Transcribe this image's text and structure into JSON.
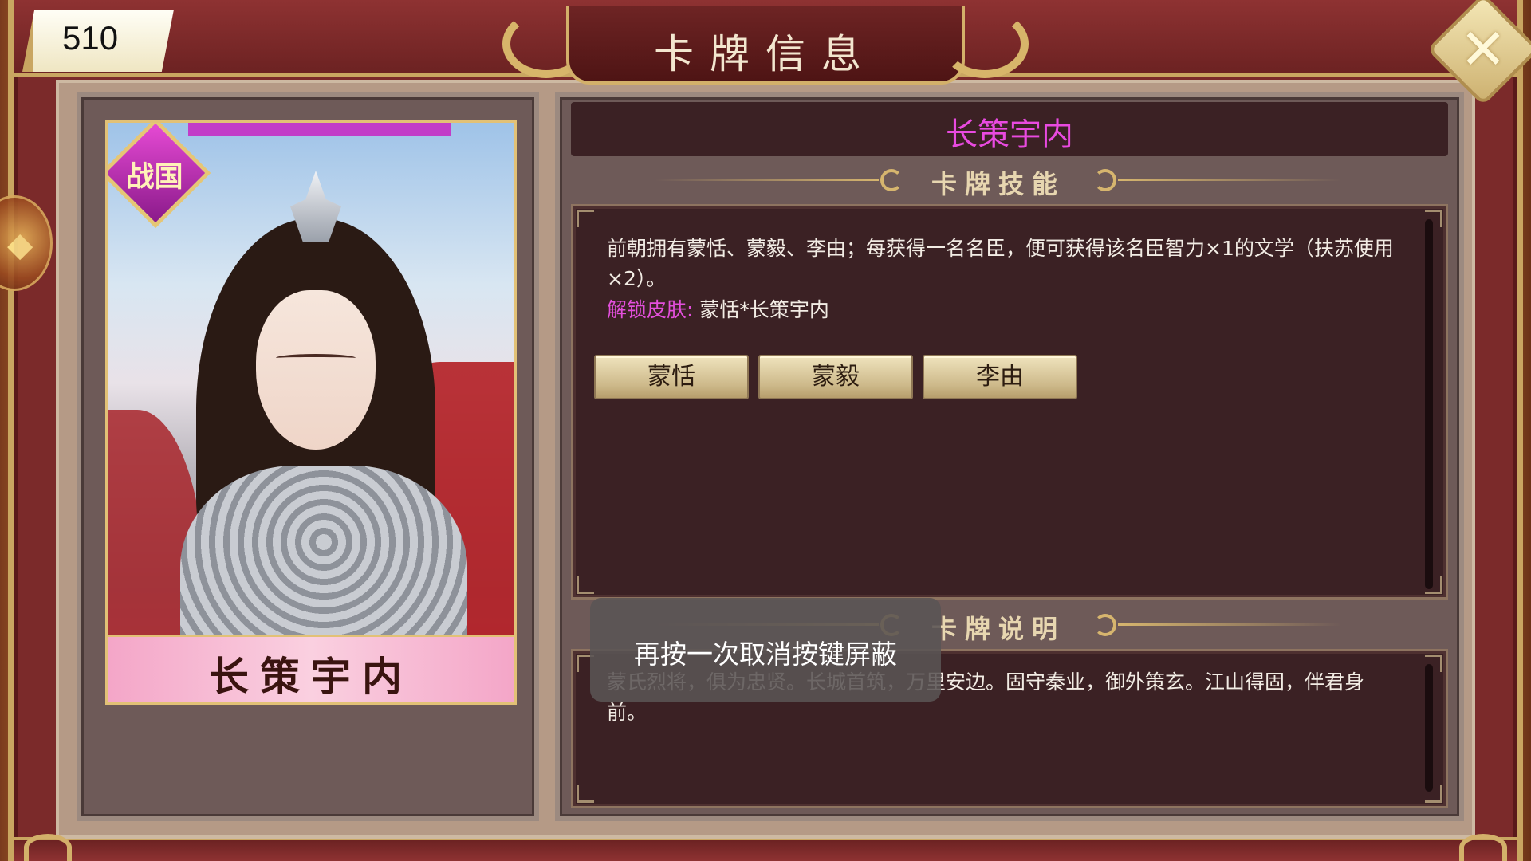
{
  "score": "510",
  "title": "卡牌信息",
  "close_icon": "close-x-icon",
  "card": {
    "name": "长策宇内",
    "badge": "战国",
    "art_icon": "armored-warrior-portrait"
  },
  "info": {
    "card_name": "长策宇内",
    "skill_heading": "卡牌技能",
    "skill_text": "前朝拥有蒙恬、蒙毅、李由；每获得一名名臣，便可获得该名臣智力×1的文学（扶苏使用×2）。",
    "skin_label": "解锁皮肤:",
    "skin_value": "蒙恬*长策宇内",
    "ministers": [
      "蒙恬",
      "蒙毅",
      "李由"
    ],
    "desc_heading": "卡牌说明",
    "desc_text": "蒙氏烈将，俱为忠贤。长城首筑，万里安边。固守秦业，御外策玄。江山得固，伴君身前。"
  },
  "toast": "再按一次取消按键屏蔽",
  "colors": {
    "accent_pink": "#e94ae0",
    "frame_red": "#7b2a2a",
    "gold": "#d3b06a"
  }
}
